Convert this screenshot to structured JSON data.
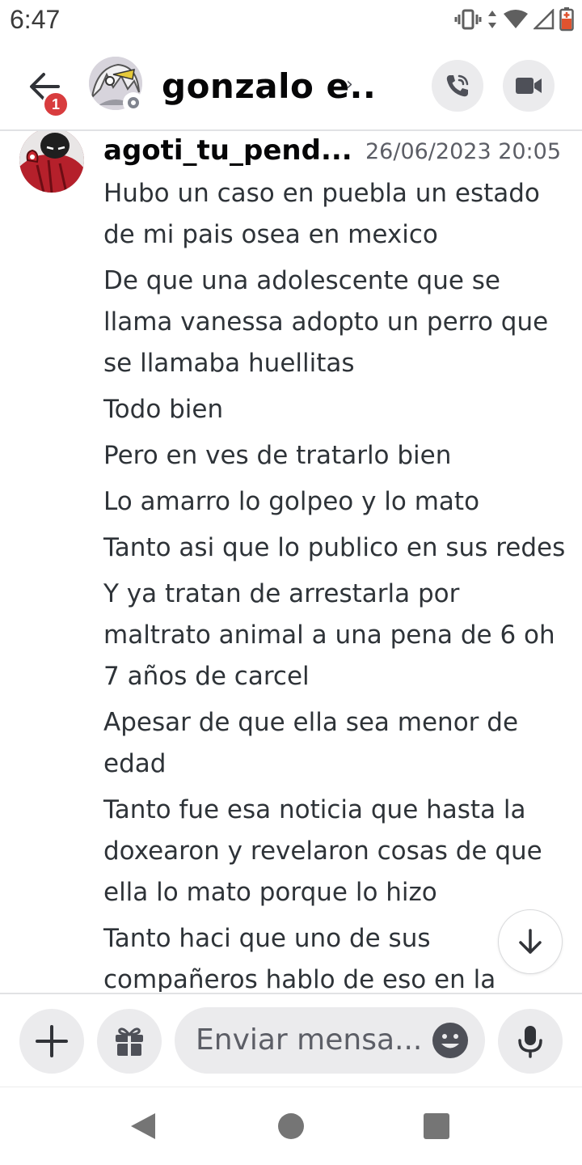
{
  "status_bar": {
    "time": "6:47",
    "icons": [
      "vibrate-icon",
      "data-arrows-icon",
      "wifi-icon",
      "signal-icon",
      "battery-low-icon"
    ]
  },
  "header": {
    "back_badge_count": "1",
    "title": "gonzalo e..",
    "chevron": "›",
    "status": "offline",
    "icons": [
      "back-arrow-icon",
      "phone-call-icon",
      "video-camera-icon"
    ]
  },
  "message": {
    "author": "agoti_tu_pend...",
    "timestamp": "26/06/2023 20:05",
    "lines": [
      "Hubo un caso en puebla un estado de mi pais osea en mexico",
      "De que una adolescente que se llama vanessa adopto un perro que se llamaba huellitas",
      "Todo bien",
      "Pero en ves de tratarlo bien",
      "Lo amarro lo golpeo y lo mato",
      "Tanto asi que lo publico en sus redes",
      "Y ya tratan de arrestarla por maltrato animal a una pena de 6 oh 7 años de carcel",
      "Apesar de que ella sea menor de edad",
      "Tanto fue esa noticia que hasta la doxearon y revelaron cosas de que ella lo mato porque lo hizo",
      "Tanto haci que uno de sus compañeros hablo de eso en la"
    ]
  },
  "composer": {
    "placeholder": "Enviar mensa...",
    "icons": [
      "plus-icon",
      "gift-icon",
      "emoji-icon",
      "microphone-icon"
    ]
  },
  "nav_bar": {
    "icons": [
      "nav-back-icon",
      "nav-home-icon",
      "nav-recents-icon"
    ]
  },
  "colors": {
    "badge": "#d83c3e",
    "button_bg": "#ebebed",
    "text": "#2e3338",
    "muted": "#5c5e66"
  }
}
